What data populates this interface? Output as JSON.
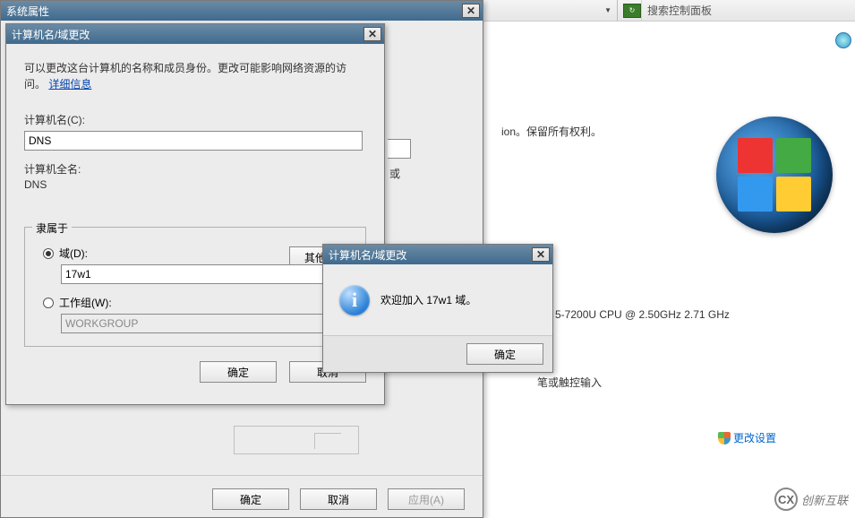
{
  "bg": {
    "search_placeholder": "搜索控制面板",
    "info_text": "ion。保留所有权利。",
    "cpu_text": "5-7200U CPU @ 2.50GHz   2.71 GHz",
    "touch_text": "笔或触控输入",
    "change_link": "更改设置"
  },
  "sysprops": {
    "title": "系统属性",
    "ok": "确定",
    "cancel": "取消",
    "apply": "应用(A)"
  },
  "namechg": {
    "title": "计算机名/域更改",
    "desc1": "可以更改这台计算机的名称和成员身份。更改可能影响网络资源的访问。",
    "more_info": "详细信息",
    "name_label": "计算机名(C):",
    "name_value": "DNS",
    "fullname_label": "计算机全名:",
    "fullname_value": "DNS",
    "other_btn": "其他(M)...",
    "group_legend": "隶属于",
    "domain_label": "域(D):",
    "domain_value": "17w1",
    "workgroup_label": "工作组(W):",
    "workgroup_value": "WORKGROUP",
    "ok": "确定",
    "cancel": "取消",
    "peek_label": "或"
  },
  "msgbox": {
    "title": "计算机名/域更改",
    "message": "欢迎加入 17w1 域。",
    "ok": "确定"
  },
  "watermark": {
    "text": "创新互联"
  }
}
